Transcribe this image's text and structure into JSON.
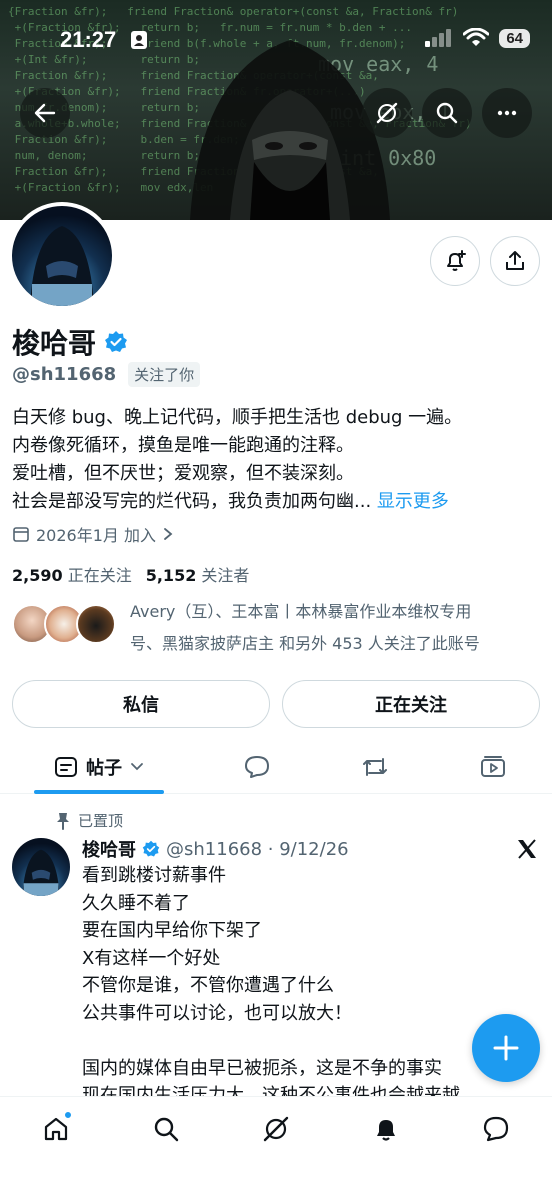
{
  "status_bar": {
    "time": "21:27",
    "battery": "64"
  },
  "profile": {
    "name": "梭哈哥",
    "handle": "@sh11668",
    "follows_you": "关注了你",
    "bio_lines": [
      "白天修 bug、晚上记代码，顺手把生活也 debug 一遍。",
      "内卷像死循环，摸鱼是唯一能跑通的注释。",
      "爱吐槽，但不厌世；爱观察，但不装深刻。",
      "社会是部没写完的烂代码，我负责加两句幽..."
    ],
    "show_more": "显示更多",
    "joined": "2026年1月 加入",
    "following_count": "2,590",
    "following_label": "正在关注",
    "followers_count": "5,152",
    "followers_label": "关注者",
    "known_followers_line1": "Avery（互）、王本富丨本林暴富作业本维权专用",
    "known_followers_line2": "号、黑猫家披萨店主 和另外 453 人关注了此账号"
  },
  "actions": {
    "message": "私信",
    "following": "正在关注"
  },
  "tabs": {
    "posts": "帖子"
  },
  "post": {
    "pinned_label": "已置顶",
    "author": "梭哈哥",
    "handle_date": "@sh11668 · 9/12/26",
    "body": "看到跳楼讨薪事件\n久久睡不着了\n要在国内早给你下架了\nX有这样一个好处\n不管你是谁，不管你遭遇了什么\n公共事件可以讨论，也可以放大！\n\n国内的媒体自由早已被扼杀，这是不争的事实\n现在国内生活压力大，这种不公事件也会越来越"
  },
  "colors": {
    "accent": "#1d9bf0",
    "text": "#0f1419",
    "secondary": "#536471",
    "border": "#cfd9de"
  }
}
